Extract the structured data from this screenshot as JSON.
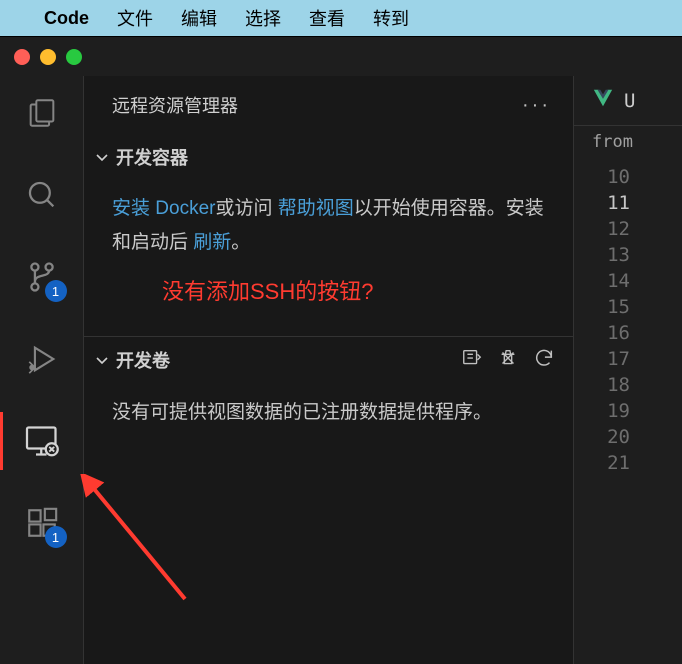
{
  "menubar": {
    "app": "Code",
    "items": [
      "文件",
      "编辑",
      "选择",
      "查看",
      "转到"
    ]
  },
  "activity": {
    "scm_badge": "1",
    "ext_badge": "1"
  },
  "sidebar": {
    "title": "远程资源管理器",
    "more": "···",
    "section1": {
      "title": "开发容器",
      "body_prefix": "",
      "link1": "安装 Docker",
      "body_mid1": "或访问 ",
      "link2": "帮助视图",
      "body_mid2": "以开始使用容器。安装和启动后 ",
      "link3": "刷新",
      "body_suffix": "。",
      "annotation": "没有添加SSH的按钮?"
    },
    "section2": {
      "title": "开发卷",
      "body": "没有可提供视图数据的已注册数据提供程序。"
    }
  },
  "editor": {
    "tab_label": "U",
    "breadcrumb": "from",
    "line_numbers": [
      "10",
      "11",
      "12",
      "13",
      "14",
      "15",
      "16",
      "17",
      "18",
      "19",
      "20",
      "21"
    ],
    "current_line": "11"
  }
}
